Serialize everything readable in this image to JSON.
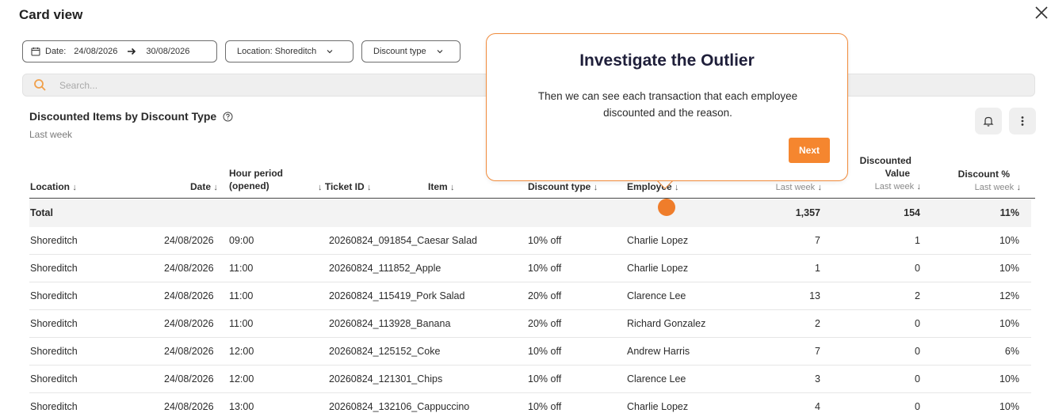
{
  "window": {
    "title": "Card view"
  },
  "filters": {
    "date_label": "Date:",
    "date_from": "24/08/2026",
    "date_to": "30/08/2026",
    "location": "Location: Shoreditch",
    "discount_type": "Discount type"
  },
  "search": {
    "placeholder": "Search..."
  },
  "card": {
    "title": "Discounted Items by Discount Type",
    "subtitle": "Last week"
  },
  "columns": {
    "location": "Location",
    "date": "Date",
    "hour_1": "Hour period",
    "hour_2": "(opened)",
    "ticket": "Ticket ID",
    "item": "Item",
    "discount_type": "Discount type",
    "employee": "Employee",
    "qty_sub": "Last week",
    "value_1": "Discounted",
    "value_2": "Value",
    "value_sub": "Last week",
    "pct": "Discount %",
    "pct_sub": "Last week"
  },
  "total": {
    "label": "Total",
    "qty": "1,357",
    "value": "154",
    "pct": "11%"
  },
  "rows": [
    {
      "location": "Shoreditch",
      "date": "24/08/2026",
      "hour": "09:00",
      "ticket_item": "20260824_091854_Caesar Salad",
      "discount": "10% off",
      "employee": "Charlie Lopez",
      "qty": "7",
      "value": "1",
      "pct": "10%"
    },
    {
      "location": "Shoreditch",
      "date": "24/08/2026",
      "hour": "11:00",
      "ticket_item": "20260824_111852_Apple",
      "discount": "10% off",
      "employee": "Charlie Lopez",
      "qty": "1",
      "value": "0",
      "pct": "10%"
    },
    {
      "location": "Shoreditch",
      "date": "24/08/2026",
      "hour": "11:00",
      "ticket_item": "20260824_115419_Pork Salad",
      "discount": "20% off",
      "employee": "Clarence Lee",
      "qty": "13",
      "value": "2",
      "pct": "12%"
    },
    {
      "location": "Shoreditch",
      "date": "24/08/2026",
      "hour": "11:00",
      "ticket_item": "20260824_113928_Banana",
      "discount": "20% off",
      "employee": "Richard Gonzalez",
      "qty": "2",
      "value": "0",
      "pct": "10%"
    },
    {
      "location": "Shoreditch",
      "date": "24/08/2026",
      "hour": "12:00",
      "ticket_item": "20260824_125152_Coke",
      "discount": "10% off",
      "employee": "Andrew Harris",
      "qty": "7",
      "value": "0",
      "pct": "6%"
    },
    {
      "location": "Shoreditch",
      "date": "24/08/2026",
      "hour": "12:00",
      "ticket_item": "20260824_121301_Chips",
      "discount": "10% off",
      "employee": "Clarence Lee",
      "qty": "3",
      "value": "0",
      "pct": "10%"
    },
    {
      "location": "Shoreditch",
      "date": "24/08/2026",
      "hour": "13:00",
      "ticket_item": "20260824_132106_Cappuccino",
      "discount": "10% off",
      "employee": "Charlie Lopez",
      "qty": "4",
      "value": "0",
      "pct": "10%"
    }
  ],
  "tooltip": {
    "title": "Investigate the Outlier",
    "body": "Then we can see each transaction that each employee discounted and the reason.",
    "next_label": "Next"
  },
  "icons": {
    "close": "close-icon",
    "calendar": "calendar-icon",
    "arrow": "arrow-right-icon",
    "chevron": "chevron-down-icon",
    "search": "search-icon",
    "help": "help-circle-icon",
    "bell": "bell-icon",
    "more": "more-vertical-icon"
  },
  "colors": {
    "accent": "#f5862f",
    "tooltip_border": "#f08a3a",
    "search_icon": "#f0a04b"
  }
}
